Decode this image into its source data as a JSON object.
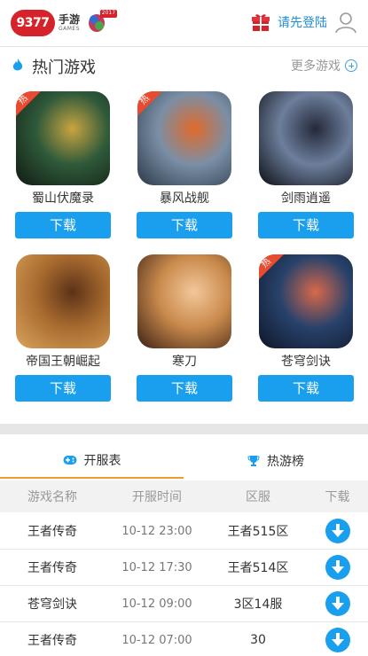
{
  "header": {
    "logo_number": "9377",
    "logo_cn": "手游",
    "logo_en": "GAMES",
    "logo_tag": "2017",
    "login_label": "请先登陆"
  },
  "hot_section": {
    "title": "热门游戏",
    "more_label": "更多游戏",
    "hot_tag": "热"
  },
  "games": [
    {
      "name": "蜀山伏魔录",
      "download": "下载",
      "hot": true,
      "colors": [
        "#2f5a3a",
        "#c9a441",
        "#101a12"
      ]
    },
    {
      "name": "暴风战舰",
      "download": "下载",
      "hot": true,
      "colors": [
        "#7a8fa6",
        "#e06a2a",
        "#2b3847"
      ]
    },
    {
      "name": "剑雨逍遥",
      "download": "下载",
      "hot": false,
      "colors": [
        "#6d7f9c",
        "#24293a",
        "#0b0d14"
      ]
    },
    {
      "name": "帝国王朝崛起",
      "download": "下载",
      "hot": false,
      "colors": [
        "#a86b2f",
        "#5c3218",
        "#d9a35c"
      ]
    },
    {
      "name": "寒刀",
      "download": "下载",
      "hot": false,
      "colors": [
        "#c98a4c",
        "#f3c79a",
        "#3b1f14"
      ]
    },
    {
      "name": "苍穹剑诀",
      "download": "下载",
      "hot": true,
      "colors": [
        "#28426b",
        "#d9684a",
        "#0e1628"
      ]
    }
  ],
  "tabs": [
    {
      "label": "开服表",
      "icon": "gamepad-icon"
    },
    {
      "label": "热游榜",
      "icon": "trophy-icon"
    }
  ],
  "table": {
    "columns": [
      "游戏名称",
      "开服时间",
      "区服",
      "下载"
    ],
    "rows": [
      {
        "game": "王者传奇",
        "time": "10-12  23:00",
        "server": "王者515区"
      },
      {
        "game": "王者传奇",
        "time": "10-12  17:30",
        "server": "王者514区"
      },
      {
        "game": "苍穹剑诀",
        "time": "10-12  09:00",
        "server": "3区14服"
      },
      {
        "game": "王者传奇",
        "time": "10-12  07:00",
        "server": "30"
      }
    ]
  },
  "colors": {
    "accent_blue": "#1a9fef",
    "brand_red": "#d6222a",
    "tab_underline": "#f29a2e",
    "hot_tag": "#e84b2f"
  }
}
